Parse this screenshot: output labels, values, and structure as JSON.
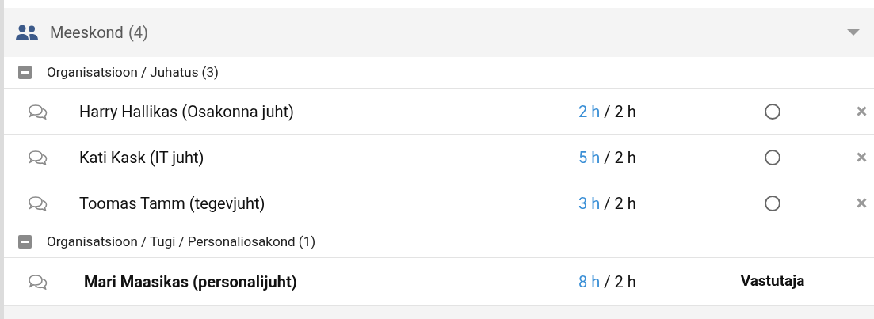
{
  "panel": {
    "title": "Meeskond",
    "count": "(4)",
    "expanded": true
  },
  "groups": [
    {
      "label": "Organisatsioon / Juhatus (3)",
      "expanded": true,
      "members": [
        {
          "kind": "radio",
          "name": "Harry Hallikas (Osakonna juht)",
          "spent": "2 h",
          "planned": "/ 2 h",
          "selected": false
        },
        {
          "kind": "radio",
          "name": "Kati Kask (IT juht)",
          "spent": "5 h",
          "planned": "/ 2 h",
          "selected": false
        },
        {
          "kind": "radio",
          "name": "Toomas Tamm (tegevjuht)",
          "spent": "3 h",
          "planned": "/ 2 h",
          "selected": false
        }
      ]
    },
    {
      "label": "Organisatsioon / Tugi / Personaliosakond (1)",
      "expanded": true,
      "members": [
        {
          "kind": "role",
          "name": "Mari Maasikas (personalijuht)",
          "spent": "8 h",
          "planned": "/ 2 h",
          "role": "Vastutaja"
        }
      ]
    }
  ]
}
